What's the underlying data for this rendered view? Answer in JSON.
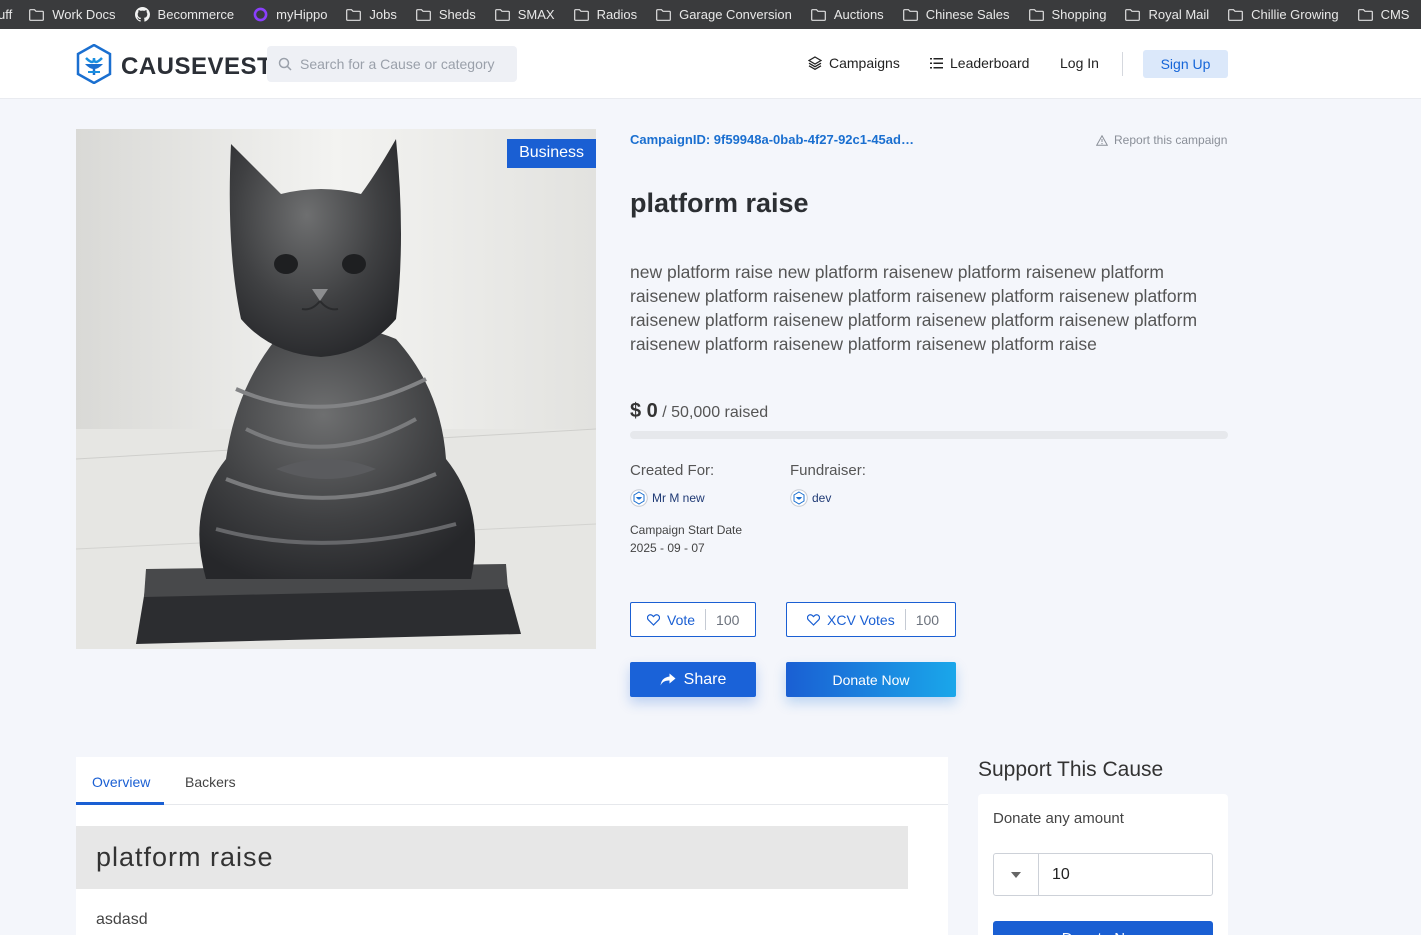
{
  "bookmarks": [
    {
      "label": "uff",
      "icon": "none"
    },
    {
      "label": "Work Docs",
      "icon": "folder-icon"
    },
    {
      "label": "Becommerce",
      "icon": "github-icon"
    },
    {
      "label": "myHippo",
      "icon": "ring-icon"
    },
    {
      "label": "Jobs",
      "icon": "folder-icon"
    },
    {
      "label": "Sheds",
      "icon": "folder-icon"
    },
    {
      "label": "SMAX",
      "icon": "folder-icon"
    },
    {
      "label": "Radios",
      "icon": "folder-icon"
    },
    {
      "label": "Garage Conversion",
      "icon": "folder-icon"
    },
    {
      "label": "Auctions",
      "icon": "folder-icon"
    },
    {
      "label": "Chinese Sales",
      "icon": "folder-icon"
    },
    {
      "label": "Shopping",
      "icon": "folder-icon"
    },
    {
      "label": "Royal Mail",
      "icon": "folder-icon"
    },
    {
      "label": "Chillie Growing",
      "icon": "folder-icon"
    },
    {
      "label": "CMS",
      "icon": "folder-icon"
    }
  ],
  "header": {
    "logo_text": "CAUSEVEST",
    "search_placeholder": "Search for a Cause or category",
    "nav_campaigns": "Campaigns",
    "nav_leaderboard": "Leaderboard",
    "nav_login": "Log In",
    "nav_signup": "Sign Up"
  },
  "campaign": {
    "category_badge": "Business",
    "campaign_id": "CampaignID: 9f59948a-0bab-4f27-92c1-45ad…",
    "report_label": "Report this campaign",
    "title": "platform raise",
    "description": "new platform raise new platform raisenew platform raisenew platform raisenew platform raisenew platform raisenew platform raisenew platform raisenew platform raisenew platform raisenew platform raisenew platform raisenew platform raisenew platform raisenew platform raise",
    "raised_amount": "$ 0",
    "raised_goal": "/ 50,000 raised",
    "progress_fraction": 0,
    "created_for_label": "Created For:",
    "created_for_name": "Mr M new",
    "fundraiser_label": "Fundraiser:",
    "fundraiser_name": "dev",
    "start_date_label": "Campaign Start Date",
    "start_date": "2025 - 09 - 07",
    "vote_label": "Vote",
    "vote_count": "100",
    "xcv_label": "XCV Votes",
    "xcv_count": "100",
    "share_label": "Share",
    "donate_label": "Donate Now"
  },
  "tabs": {
    "overview": "Overview",
    "backers": "Backers",
    "overview_title": "platform raise",
    "overview_text": "asdasd"
  },
  "support": {
    "heading": "Support This Cause",
    "donate_any": "Donate any amount",
    "amount_value": "10",
    "donate_button": "Donate Now"
  },
  "colors": {
    "brand": "#1a5fd3",
    "accent": "#1aa7ea",
    "bookmarks_bg": "#3a3b3d"
  }
}
